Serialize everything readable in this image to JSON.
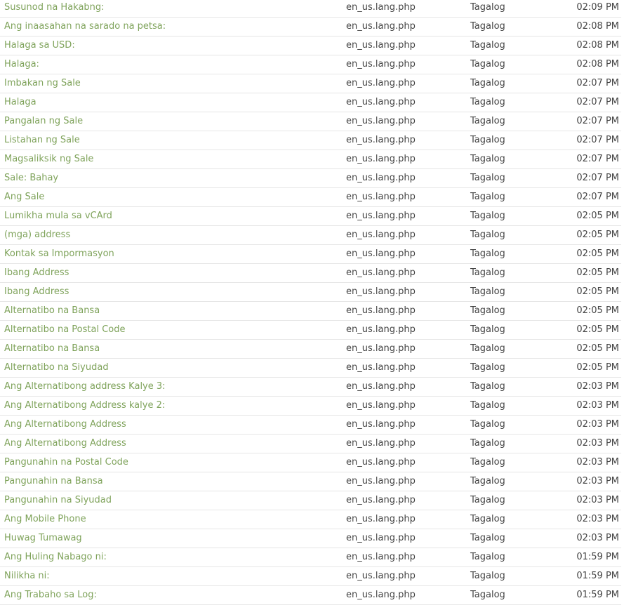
{
  "rows": [
    {
      "label": "Susunod na Hakabng:",
      "file": "en_us.lang.php",
      "language": "Tagalog",
      "time": "02:09 PM"
    },
    {
      "label": "Ang inaasahan na sarado na petsa:",
      "file": "en_us.lang.php",
      "language": "Tagalog",
      "time": "02:08 PM"
    },
    {
      "label": "Halaga sa USD:",
      "file": "en_us.lang.php",
      "language": "Tagalog",
      "time": "02:08 PM"
    },
    {
      "label": "Halaga:",
      "file": "en_us.lang.php",
      "language": "Tagalog",
      "time": "02:08 PM"
    },
    {
      "label": "Imbakan ng Sale",
      "file": "en_us.lang.php",
      "language": "Tagalog",
      "time": "02:07 PM"
    },
    {
      "label": "Halaga",
      "file": "en_us.lang.php",
      "language": "Tagalog",
      "time": "02:07 PM"
    },
    {
      "label": "Pangalan ng Sale",
      "file": "en_us.lang.php",
      "language": "Tagalog",
      "time": "02:07 PM"
    },
    {
      "label": "Listahan ng Sale",
      "file": "en_us.lang.php",
      "language": "Tagalog",
      "time": "02:07 PM"
    },
    {
      "label": "Magsaliksik ng Sale",
      "file": "en_us.lang.php",
      "language": "Tagalog",
      "time": "02:07 PM"
    },
    {
      "label": "Sale: Bahay",
      "file": "en_us.lang.php",
      "language": "Tagalog",
      "time": "02:07 PM"
    },
    {
      "label": "Ang Sale",
      "file": "en_us.lang.php",
      "language": "Tagalog",
      "time": "02:07 PM"
    },
    {
      "label": "Lumikha mula sa vCArd",
      "file": "en_us.lang.php",
      "language": "Tagalog",
      "time": "02:05 PM"
    },
    {
      "label": "(mga) address",
      "file": "en_us.lang.php",
      "language": "Tagalog",
      "time": "02:05 PM"
    },
    {
      "label": "Kontak sa Impormasyon",
      "file": "en_us.lang.php",
      "language": "Tagalog",
      "time": "02:05 PM"
    },
    {
      "label": "Ibang Address",
      "file": "en_us.lang.php",
      "language": "Tagalog",
      "time": "02:05 PM"
    },
    {
      "label": "Ibang Address",
      "file": "en_us.lang.php",
      "language": "Tagalog",
      "time": "02:05 PM"
    },
    {
      "label": "Alternatibo na Bansa",
      "file": "en_us.lang.php",
      "language": "Tagalog",
      "time": "02:05 PM"
    },
    {
      "label": "Alternatibo na Postal Code",
      "file": "en_us.lang.php",
      "language": "Tagalog",
      "time": "02:05 PM"
    },
    {
      "label": "Alternatibo na Bansa",
      "file": "en_us.lang.php",
      "language": "Tagalog",
      "time": "02:05 PM"
    },
    {
      "label": "Alternatibo na Siyudad",
      "file": "en_us.lang.php",
      "language": "Tagalog",
      "time": "02:05 PM"
    },
    {
      "label": "Ang Alternatibong address Kalye 3:",
      "file": "en_us.lang.php",
      "language": "Tagalog",
      "time": "02:03 PM"
    },
    {
      "label": "Ang Alternatibong Address kalye 2:",
      "file": "en_us.lang.php",
      "language": "Tagalog",
      "time": "02:03 PM"
    },
    {
      "label": "Ang Alternatibong Address",
      "file": "en_us.lang.php",
      "language": "Tagalog",
      "time": "02:03 PM"
    },
    {
      "label": "Ang Alternatibong Address",
      "file": "en_us.lang.php",
      "language": "Tagalog",
      "time": "02:03 PM"
    },
    {
      "label": "Pangunahin na Postal Code",
      "file": "en_us.lang.php",
      "language": "Tagalog",
      "time": "02:03 PM"
    },
    {
      "label": "Pangunahin na Bansa",
      "file": "en_us.lang.php",
      "language": "Tagalog",
      "time": "02:03 PM"
    },
    {
      "label": "Pangunahin na Siyudad",
      "file": "en_us.lang.php",
      "language": "Tagalog",
      "time": "02:03 PM"
    },
    {
      "label": "Ang Mobile Phone",
      "file": "en_us.lang.php",
      "language": "Tagalog",
      "time": "02:03 PM"
    },
    {
      "label": "Huwag Tumawag",
      "file": "en_us.lang.php",
      "language": "Tagalog",
      "time": "02:03 PM"
    },
    {
      "label": "Ang Huling Nabago ni:",
      "file": "en_us.lang.php",
      "language": "Tagalog",
      "time": "01:59 PM"
    },
    {
      "label": "Nilikha ni:",
      "file": "en_us.lang.php",
      "language": "Tagalog",
      "time": "01:59 PM"
    },
    {
      "label": "Ang Trabaho sa Log:",
      "file": "en_us.lang.php",
      "language": "Tagalog",
      "time": "01:59 PM"
    }
  ],
  "colors": {
    "link": "#7fa35b",
    "text": "#444444",
    "divider": "#e6e6e6"
  }
}
